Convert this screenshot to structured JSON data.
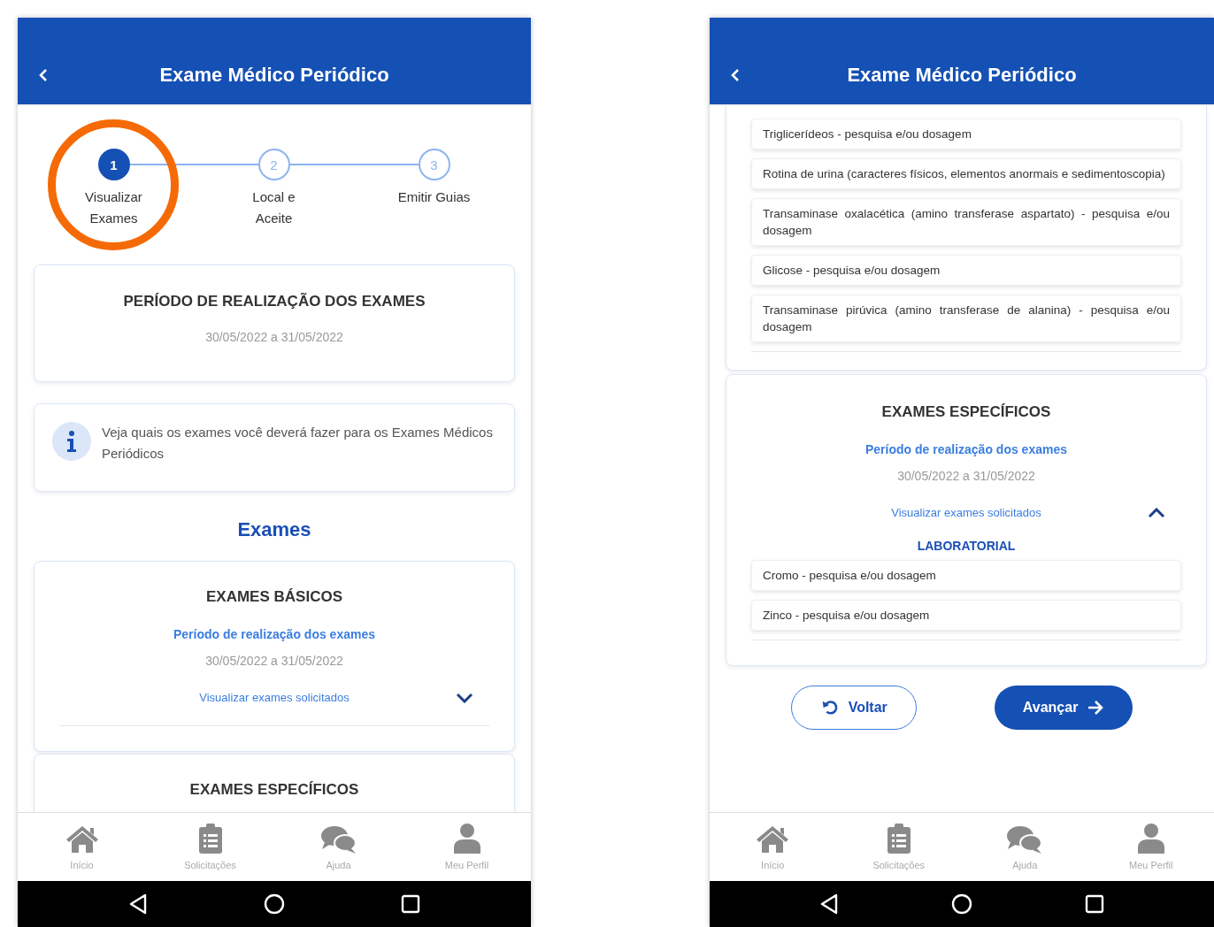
{
  "screens": [
    {
      "header": {
        "title": "Exame Médico Periódico"
      },
      "blocks": [
        {
          "kind": "stepper",
          "steps": [
            {
              "number": "1",
              "label": "Visualizar Exames",
              "selected": true,
              "highlighted": true
            },
            {
              "number": "2",
              "label": "Local e Aceite",
              "selected": false,
              "highlighted": false
            },
            {
              "number": "3",
              "label": "Emitir Guias",
              "selected": false,
              "highlighted": false
            }
          ]
        },
        {
          "kind": "period_card",
          "title": "PERÍODO DE REALIZAÇÃO DOS EXAMES",
          "period": "30/05/2022 a 31/05/2022"
        },
        {
          "kind": "info_card",
          "text": "Veja quais os exames você deverá fazer para os Exames Médicos Periódicos"
        },
        {
          "kind": "section_title",
          "text": "Exames"
        },
        {
          "kind": "exam_group",
          "title": "EXAMES BÁSICOS",
          "period_label": "Período de realização dos exames",
          "period": "30/05/2022 a 31/05/2022",
          "toggle_label": "Visualizar exames solicitados",
          "expanded": false
        },
        {
          "kind": "exam_group",
          "title": "EXAMES ESPECÍFICOS"
        }
      ],
      "bottom_nav": [
        {
          "label": "Início"
        },
        {
          "label": "Solicitações"
        },
        {
          "label": "Ajuda"
        },
        {
          "label": "Meu Perfil"
        }
      ]
    },
    {
      "header": {
        "title": "Exame Médico Periódico"
      },
      "blocks": [
        {
          "kind": "exam_list",
          "items": [
            "Triglicerídeos - pesquisa e/ou dosagem",
            "Rotina de urina (caracteres físicos, elementos anormais e sedimentoscopia)",
            "Transaminase oxalacética (amino transferase aspartato) - pesquisa e/ou dosagem",
            "Glicose - pesquisa e/ou dosagem",
            "Transaminase pirúvica (amino transferase de alanina) - pesquisa e/ou dosagem"
          ]
        },
        {
          "kind": "exam_group",
          "title": "EXAMES ESPECÍFICOS",
          "period_label": "Período de realização dos exames",
          "period": "30/05/2022 a 31/05/2022",
          "toggle_label": "Visualizar exames solicitados",
          "expanded": true,
          "category": "LABORATORIAL",
          "items": [
            "Cromo - pesquisa e/ou dosagem",
            "Zinco - pesquisa e/ou dosagem"
          ]
        },
        {
          "kind": "actions",
          "back": "Voltar",
          "next": "Avançar"
        }
      ],
      "bottom_nav": [
        {
          "label": "Início"
        },
        {
          "label": "Solicitações"
        },
        {
          "label": "Ajuda"
        },
        {
          "label": "Meu Perfil"
        }
      ]
    }
  ]
}
